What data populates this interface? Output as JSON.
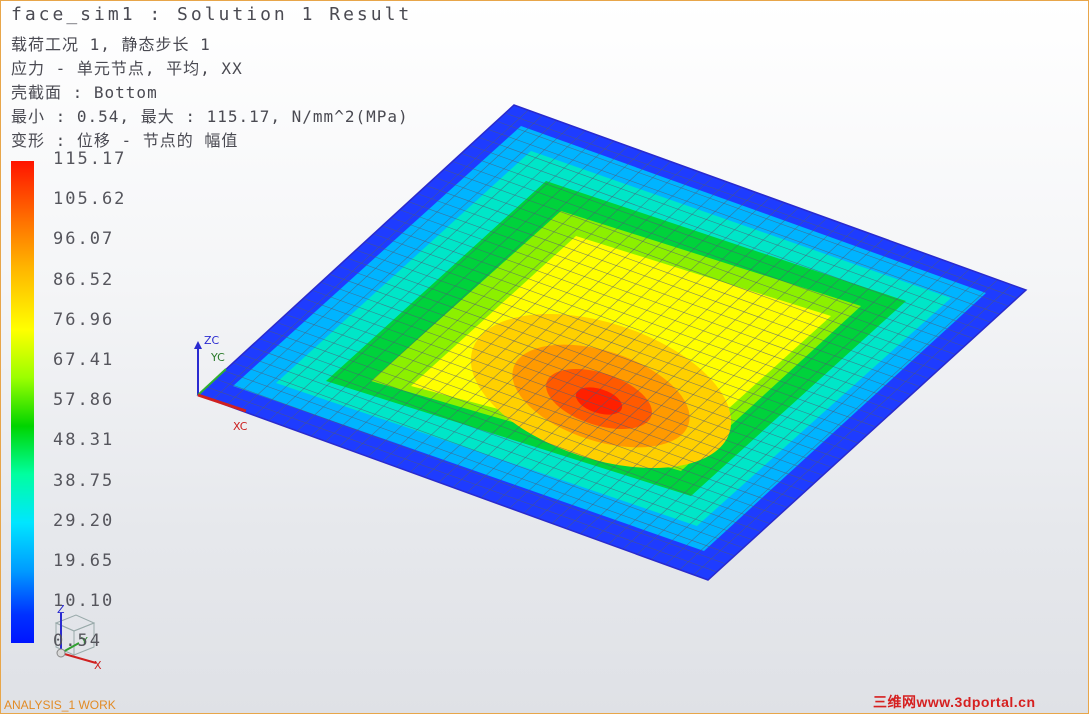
{
  "header": {
    "title": "face_sim1 : Solution 1 Result",
    "load_case": "载荷工况 1, 静态步长 1",
    "stress": "应力 - 单元节点, 平均, XX",
    "shell_section": "壳截面 : Bottom",
    "min_max": "最小 : 0.54, 最大 : 115.17, N/mm^2(MPa)",
    "deformation": "变形 : 位移 - 节点的 幅值"
  },
  "legend": {
    "ticks": [
      "115.17",
      "105.62",
      "96.07",
      "86.52",
      "76.96",
      "67.41",
      "57.86",
      "48.31",
      "38.75",
      "29.20",
      "19.65",
      "10.10",
      "0.54"
    ],
    "colors": [
      "#ff1400",
      "#ff7800",
      "#ffc800",
      "#ffff00",
      "#96ff00",
      "#00dc00",
      "#00ffa0",
      "#00e6ff",
      "#0096ff",
      "#0028ff"
    ]
  },
  "triad": {
    "zc": "ZC",
    "yc": "YC",
    "xc": "XC"
  },
  "view_triad": {
    "z": "Z",
    "y": "Y",
    "x": "X"
  },
  "status": {
    "work_label": "ANALYSIS_1 WORK"
  },
  "watermark": "三维网www.3dportal.cn"
}
